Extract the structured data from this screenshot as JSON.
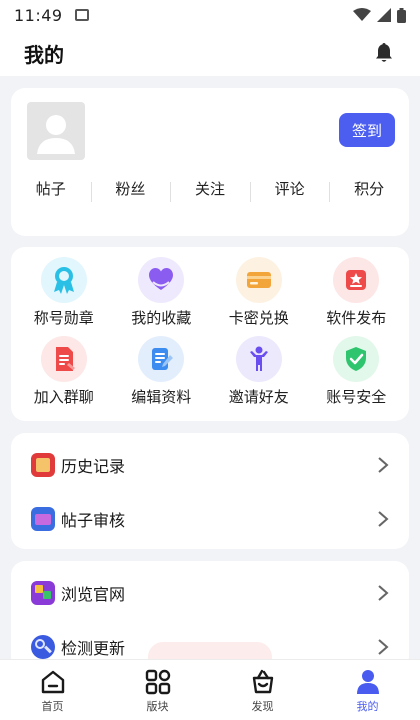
{
  "status_bar": {
    "time": "11:49"
  },
  "header": {
    "title": "我的"
  },
  "profile": {
    "checkin_label": "签到",
    "stats": [
      "帖子",
      "粉丝",
      "关注",
      "评论",
      "积分"
    ]
  },
  "grid": {
    "items": [
      {
        "label": "称号勋章",
        "icon": "medal-icon"
      },
      {
        "label": "我的收藏",
        "icon": "heart-icon"
      },
      {
        "label": "卡密兑换",
        "icon": "card-icon"
      },
      {
        "label": "软件发布",
        "icon": "app-publish-icon"
      },
      {
        "label": "加入群聊",
        "icon": "document-icon"
      },
      {
        "label": "编辑资料",
        "icon": "edit-icon"
      },
      {
        "label": "邀请好友",
        "icon": "person-icon"
      },
      {
        "label": "账号安全",
        "icon": "shield-check-icon"
      }
    ]
  },
  "list1": [
    {
      "label": "历史记录",
      "icon": "history-icon"
    },
    {
      "label": "帖子审核",
      "icon": "review-icon"
    }
  ],
  "list2": [
    {
      "label": "浏览官网",
      "icon": "website-icon"
    },
    {
      "label": "检测更新",
      "icon": "update-icon"
    }
  ],
  "tabbar": {
    "tabs": [
      {
        "label": "首页",
        "icon": "home-icon"
      },
      {
        "label": "版块",
        "icon": "grid-icon"
      },
      {
        "label": "发现",
        "icon": "discover-icon"
      },
      {
        "label": "我的",
        "icon": "user-icon"
      }
    ],
    "active_index": 3
  },
  "colors": {
    "accent": "#4c5ef0",
    "background": "#f2f3f7",
    "card": "#ffffff"
  }
}
